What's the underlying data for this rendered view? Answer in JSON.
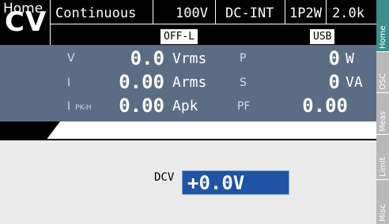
{
  "header": {
    "mode": "CV",
    "run_mode": "Continuous",
    "range": "100V",
    "source": "DC-INT",
    "wiring": "1P2W",
    "freq": "2.0k",
    "output_state": "OFF-L",
    "interface": "USB"
  },
  "measurements": [
    {
      "label": "V",
      "sub": "",
      "value": "0.0",
      "unit": "Vrms"
    },
    {
      "label": "I",
      "sub": "",
      "value": "0.00",
      "unit": "Arms"
    },
    {
      "label": "I",
      "sub": "PK-H",
      "value": "0.00",
      "unit": "Apk"
    },
    {
      "label": "P",
      "sub": "",
      "value": "0",
      "unit": "W"
    },
    {
      "label": "S",
      "sub": "",
      "value": "0",
      "unit": "VA"
    },
    {
      "label": "PF",
      "sub": "",
      "value": "0.00",
      "unit": ""
    }
  ],
  "home": {
    "title": "Home",
    "dcv_label": "DCV",
    "dcv_value": "+0.0V"
  },
  "sidebar": {
    "tabs": [
      {
        "label": "Home",
        "active": true
      },
      {
        "label": "OSC",
        "active": false
      },
      {
        "label": "Meas",
        "active": false
      },
      {
        "label": "Limit",
        "active": false
      },
      {
        "label": "Misc",
        "active": false
      }
    ]
  },
  "colors": {
    "panel": "#5b6d84",
    "active_tab": "#3a8f8c",
    "input": "#1f53a6"
  }
}
